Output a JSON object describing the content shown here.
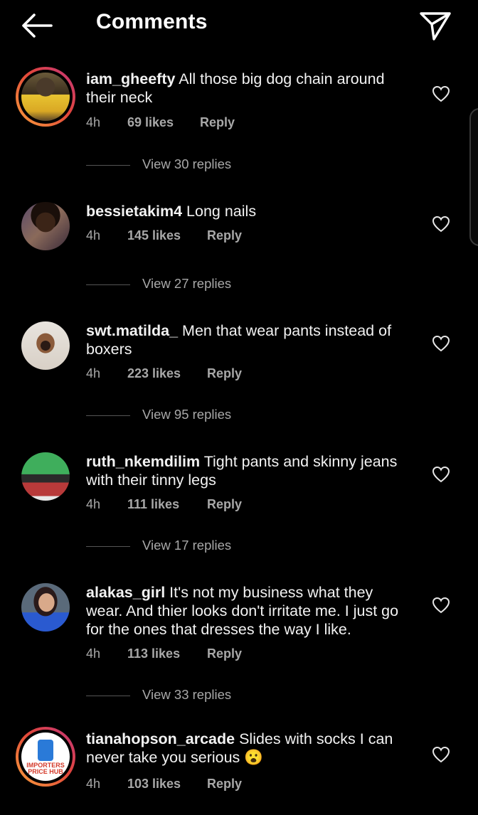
{
  "header": {
    "title": "Comments",
    "back_icon": "arrow-left-icon",
    "share_icon": "paper-plane-icon"
  },
  "comments": [
    {
      "username": "iam_gheefty",
      "text": "All those big dog chain around their neck",
      "time": "4h",
      "likes": "69 likes",
      "reply": "Reply",
      "view_replies": "View 30 replies",
      "avatar_ring": true
    },
    {
      "username": "bessietakim4",
      "text": "Long nails",
      "time": "4h",
      "likes": "145 likes",
      "reply": "Reply",
      "view_replies": "View 27 replies",
      "avatar_ring": false
    },
    {
      "username": "swt.matilda_",
      "text": "Men that wear pants instead of boxers",
      "time": "4h",
      "likes": "223 likes",
      "reply": "Reply",
      "view_replies": "View 95 replies",
      "avatar_ring": false
    },
    {
      "username": "ruth_nkemdilim",
      "text": "Tight pants and skinny jeans with their tinny legs",
      "time": "4h",
      "likes": "111 likes",
      "reply": "Reply",
      "view_replies": "View 17 replies",
      "avatar_ring": false
    },
    {
      "username": "alakas_girl",
      "text": "It's not my business what they wear. And thier looks don't irritate me.  I just go for the ones that dresses the way I like.",
      "time": "4h",
      "likes": "113 likes",
      "reply": "Reply",
      "view_replies": "View 33 replies",
      "avatar_ring": false
    },
    {
      "username": "tianahopson_arcade",
      "text": "Slides with socks I can never take you serious 😮",
      "time": "4h",
      "likes": "103 likes",
      "reply": "Reply",
      "avatar_ring": true,
      "avatar_logo_text": "IMPORTERS PRICE HUB"
    }
  ],
  "colors": {
    "background": "#000000",
    "text": "#f2f2f2",
    "secondary": "#a8a8a8",
    "story_ring": "#e2463a"
  }
}
